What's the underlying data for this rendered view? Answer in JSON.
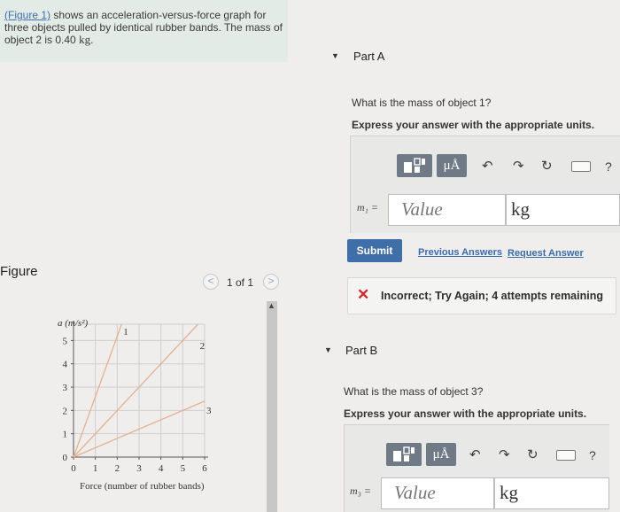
{
  "intro": {
    "figure_link": "(Figure 1)",
    "text_before_kg": " shows an acceleration-versus-force graph for three objects pulled by identical rubber bands. The mass of object 2 is 0.40 ",
    "unit_kg": "kg",
    "text_end": "."
  },
  "figure": {
    "label": "Figure",
    "pager_text": "1 of 1",
    "prev_glyph": "<",
    "next_glyph": ">"
  },
  "chart_data": {
    "type": "line",
    "ylabel": "a (m/s²)",
    "xlabel": "Force (number of rubber bands)",
    "xlim": [
      0,
      6
    ],
    "ylim": [
      0,
      5.7
    ],
    "x_ticks": [
      "0",
      "1",
      "2",
      "3",
      "4",
      "5",
      "6"
    ],
    "y_ticks": [
      "0",
      "1",
      "2",
      "3",
      "4",
      "5"
    ],
    "grid": true,
    "series": [
      {
        "name": "1",
        "x": [
          0,
          2.2
        ],
        "y": [
          0,
          5.7
        ],
        "color": "#e6b08f"
      },
      {
        "name": "2",
        "x": [
          0,
          5.7
        ],
        "y": [
          0,
          5.7
        ],
        "color": "#e6b08f"
      },
      {
        "name": "3",
        "x": [
          0,
          6
        ],
        "y": [
          0,
          2.4
        ],
        "color": "#e6b08f"
      }
    ]
  },
  "scroll": {
    "arrow": "▲"
  },
  "partA": {
    "caret": "▼",
    "title": "Part A",
    "question": "What is the mass of object 1?",
    "instruction": "Express your answer with the appropriate units.",
    "toolbar": {
      "mu_label": "μÅ",
      "undo": "↶",
      "redo": "↷",
      "reset": "↻",
      "help": "?"
    },
    "var_label": "m₁ =",
    "value_placeholder": "Value",
    "unit_value": "kg",
    "submit_label": "Submit",
    "previous_answers": "Previous Answers",
    "request_answer": "Request Answer",
    "feedback_icon": "✕",
    "feedback_text": "Incorrect; Try Again; 4 attempts remaining"
  },
  "partB": {
    "caret": "▼",
    "title": "Part B",
    "question": "What is the mass of object 3?",
    "instruction": "Express your answer with the appropriate units.",
    "toolbar": {
      "mu_label": "μÅ",
      "undo": "↶",
      "redo": "↷",
      "reset": "↻",
      "help": "?"
    },
    "var_label": "m₃ =",
    "value_placeholder": "Value",
    "unit_value": "kg"
  }
}
